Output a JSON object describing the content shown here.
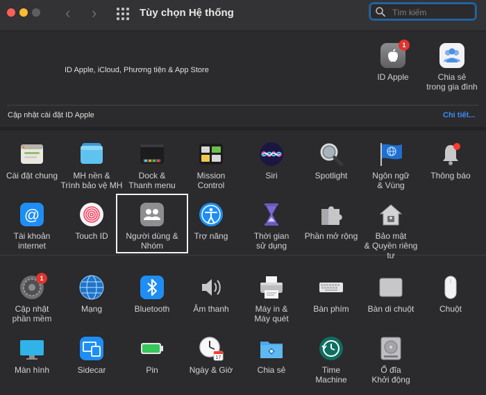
{
  "window": {
    "title": "Tùy chọn Hệ thống"
  },
  "search": {
    "placeholder": "Tìm kiếm"
  },
  "account": {
    "description": "ID Apple, iCloud, Phương tiện & App Store",
    "apple_id_label": "ID Apple",
    "apple_id_badge": "1",
    "family_label": "Chia sẻ\ntrong gia đình"
  },
  "update_banner": {
    "text": "Cập nhật cài đặt ID Apple",
    "link": "Chi tiết..."
  },
  "panes_row1": [
    {
      "label": "Cài đặt chung"
    },
    {
      "label": "MH nền &\nTrình bảo vệ MH"
    },
    {
      "label": "Dock &\nThanh menu"
    },
    {
      "label": "Mission\nControl"
    },
    {
      "label": "Siri"
    },
    {
      "label": "Spotlight"
    },
    {
      "label": "Ngôn ngữ\n& Vùng"
    },
    {
      "label": "Thông báo"
    }
  ],
  "panes_row2": [
    {
      "label": "Tài khoản\ninternet"
    },
    {
      "label": "Touch ID"
    },
    {
      "label": "Người dùng &\nNhóm"
    },
    {
      "label": "Trợ năng"
    },
    {
      "label": "Thời gian\nsử dụng"
    },
    {
      "label": "Phần mở rộng"
    },
    {
      "label": "Bảo mật\n& Quyền riêng tư"
    }
  ],
  "panes_row3": [
    {
      "label": "Cập nhật\nphần mềm",
      "badge": "1"
    },
    {
      "label": "Mạng"
    },
    {
      "label": "Bluetooth"
    },
    {
      "label": "Âm thanh"
    },
    {
      "label": "Máy in &\nMáy quét"
    },
    {
      "label": "Bàn phím"
    },
    {
      "label": "Bàn di chuột"
    },
    {
      "label": "Chuột"
    }
  ],
  "panes_row4": [
    {
      "label": "Màn hình"
    },
    {
      "label": "Sidecar"
    },
    {
      "label": "Pin"
    },
    {
      "label": "Ngày & Giờ"
    },
    {
      "label": "Chia sẻ"
    },
    {
      "label": "Time\nMachine"
    },
    {
      "label": "Ổ đĩa\nKhởi động"
    }
  ],
  "colors": {
    "accent": "#3a8ef6",
    "badge": "#e0342e",
    "background": "#2b2a2c"
  }
}
